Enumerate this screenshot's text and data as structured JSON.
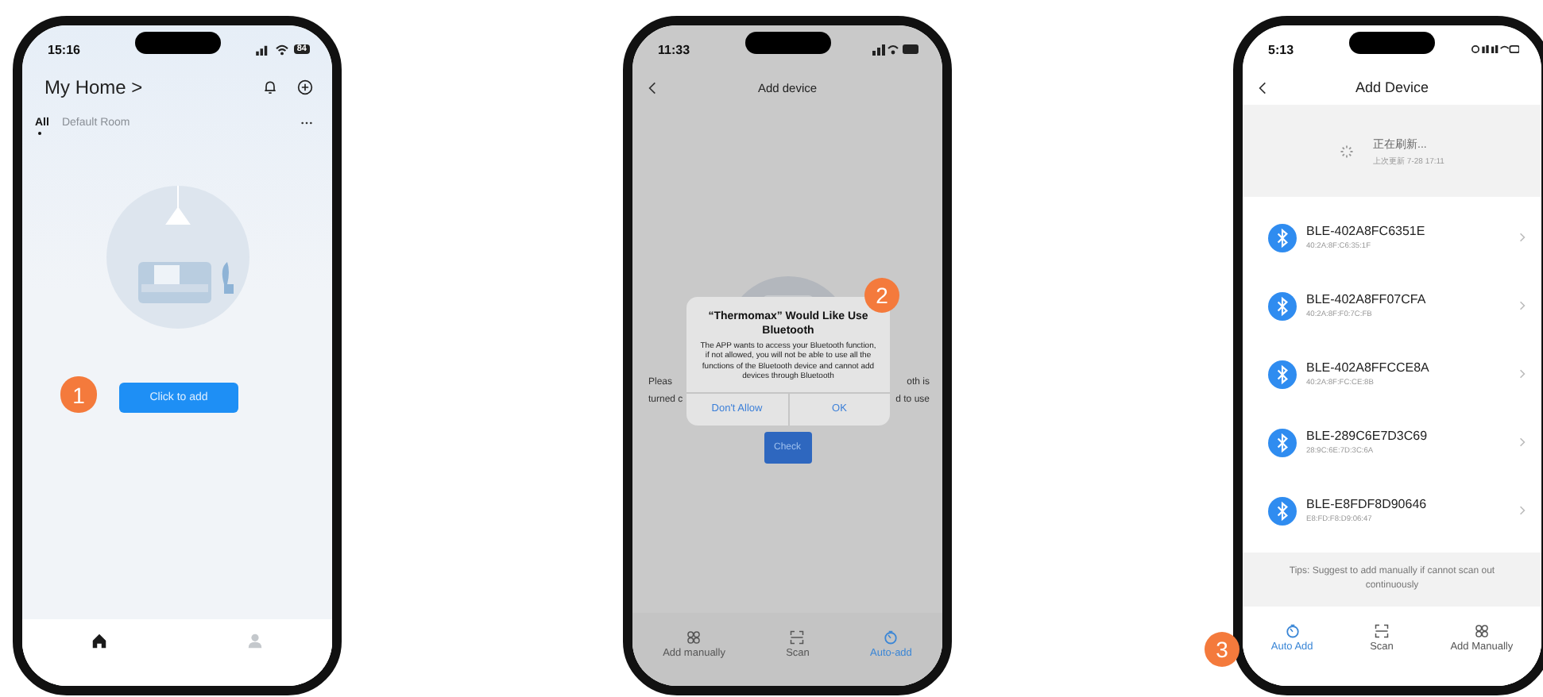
{
  "phones": [
    {
      "kind": "home",
      "step": "1",
      "status_time": "15:16",
      "battery": "84",
      "title": "My Home >",
      "tabs": [
        {
          "label": "All",
          "selected": true
        },
        {
          "label": "Default Room",
          "selected": false
        }
      ],
      "add_button": "Click to add",
      "nav": [
        {
          "kind": "home",
          "selected": true
        },
        {
          "kind": "profile",
          "selected": false
        }
      ]
    },
    {
      "kind": "bluetooth_prompt",
      "step": "2",
      "status_time": "11:33",
      "title": "Add device",
      "hint_fragments": [
        {
          "left": "Pleas",
          "right": "oth is"
        },
        {
          "left": "turned c",
          "right": "d to use"
        }
      ],
      "check_button": "Check",
      "alert": {
        "title": "“Thermomax” Would Like Use Bluetooth",
        "message": "The APP wants to access your Bluetooth function, if not allowed, you will not be able to use all the functions of the Bluetooth device and cannot add devices through Bluetooth",
        "buttons": [
          "Don't Allow",
          "OK"
        ]
      },
      "tabs": [
        {
          "kind": "grid",
          "label": "Add manually",
          "selected": false
        },
        {
          "kind": "scan",
          "label": "Scan",
          "selected": false
        },
        {
          "kind": "timer",
          "label": "Auto-add",
          "selected": true
        }
      ]
    },
    {
      "kind": "device_list",
      "step": "3",
      "status_time": "5:13",
      "title": "Add Device",
      "refresh": {
        "title": "正在刷新...",
        "subtitle": "上次更新 7-28 17:11"
      },
      "devices": [
        {
          "name": "BLE-402A8FC6351E",
          "mac": "40:2A:8F:C6:35:1F"
        },
        {
          "name": "BLE-402A8FF07CFA",
          "mac": "40:2A:8F:F0:7C:FB"
        },
        {
          "name": "BLE-402A8FFCCE8A",
          "mac": "40:2A:8F:FC:CE:8B"
        },
        {
          "name": "BLE-289C6E7D3C69",
          "mac": "28:9C:6E:7D:3C:6A"
        },
        {
          "name": "BLE-E8FDF8D90646",
          "mac": "E8:FD:F8:D9:06:47"
        }
      ],
      "tips": "Tips: Suggest to add manually if cannot scan out continuously",
      "tabs": [
        {
          "kind": "timer",
          "label": "Auto Add",
          "selected": true
        },
        {
          "kind": "scan",
          "label": "Scan",
          "selected": false
        },
        {
          "kind": "grid",
          "label": "Add Manually",
          "selected": false
        }
      ]
    }
  ]
}
